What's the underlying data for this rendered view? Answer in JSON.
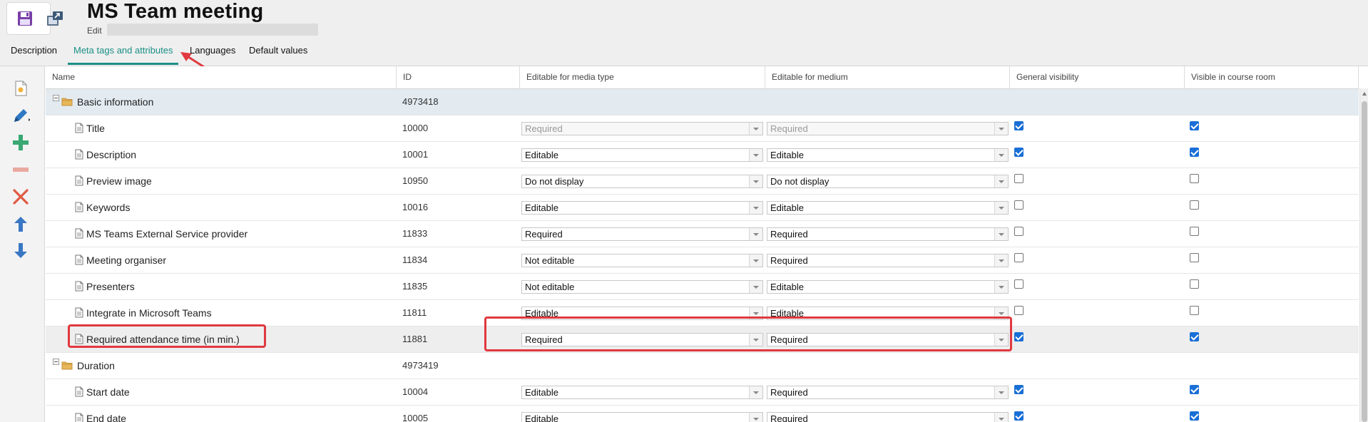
{
  "header": {
    "title": "MS Team meeting",
    "subtitle": "Edit"
  },
  "tabs": [
    {
      "label": "Description",
      "active": false
    },
    {
      "label": "Meta tags and attributes",
      "active": true
    },
    {
      "label": "Languages",
      "active": false
    },
    {
      "label": "Default values",
      "active": false
    }
  ],
  "toolbar": [
    {
      "icon": "new-page-icon"
    },
    {
      "icon": "pencil-icon"
    },
    {
      "icon": "plus-icon"
    },
    {
      "icon": "minus-icon"
    },
    {
      "icon": "delete-icon"
    },
    {
      "icon": "arrow-up-icon"
    },
    {
      "icon": "arrow-down-icon"
    }
  ],
  "columns": {
    "name": "Name",
    "id": "ID",
    "media_type": "Editable for media type",
    "medium": "Editable for medium",
    "visibility": "General visibility",
    "course_room": "Visible in course room"
  },
  "rows": [
    {
      "name": "Basic information",
      "id": "4973418",
      "group": true
    },
    {
      "name": "Title",
      "id": "10000",
      "media_type": "Required",
      "medium": "Required",
      "disabled": true,
      "visibility": true,
      "course_room": true
    },
    {
      "name": "Description",
      "id": "10001",
      "media_type": "Editable",
      "medium": "Editable",
      "visibility": true,
      "course_room": true
    },
    {
      "name": "Preview image",
      "id": "10950",
      "media_type": "Do not display",
      "medium": "Do not display",
      "visibility": false,
      "course_room": false
    },
    {
      "name": "Keywords",
      "id": "10016",
      "media_type": "Editable",
      "medium": "Editable",
      "visibility": false,
      "course_room": false
    },
    {
      "name": "MS Teams External Service provider",
      "id": "11833",
      "media_type": "Required",
      "medium": "Required",
      "visibility": false,
      "course_room": false
    },
    {
      "name": "Meeting organiser",
      "id": "11834",
      "media_type": "Not editable",
      "medium": "Required",
      "visibility": false,
      "course_room": false
    },
    {
      "name": "Presenters",
      "id": "11835",
      "media_type": "Not editable",
      "medium": "Editable",
      "visibility": false,
      "course_room": false
    },
    {
      "name": "Integrate in Microsoft Teams",
      "id": "11811",
      "media_type": "Editable",
      "medium": "Editable",
      "visibility": false,
      "course_room": false
    },
    {
      "name": "Required attendance time (in min.)",
      "id": "11881",
      "media_type": "Required",
      "medium": "Required",
      "visibility": true,
      "course_room": true,
      "selected": true
    },
    {
      "name": "Duration",
      "id": "4973419",
      "group": true,
      "plain": true
    },
    {
      "name": "Start date",
      "id": "10004",
      "media_type": "Editable",
      "medium": "Required",
      "visibility": true,
      "course_room": true
    },
    {
      "name": "End date",
      "id": "10005",
      "media_type": "Editable",
      "medium": "Required",
      "visibility": true,
      "course_room": true
    }
  ],
  "colors": {
    "accent": "#1b8f86",
    "highlight": "#e0393f",
    "group_row": "#e3ebf1",
    "checkbox": "#1a6fd6"
  }
}
